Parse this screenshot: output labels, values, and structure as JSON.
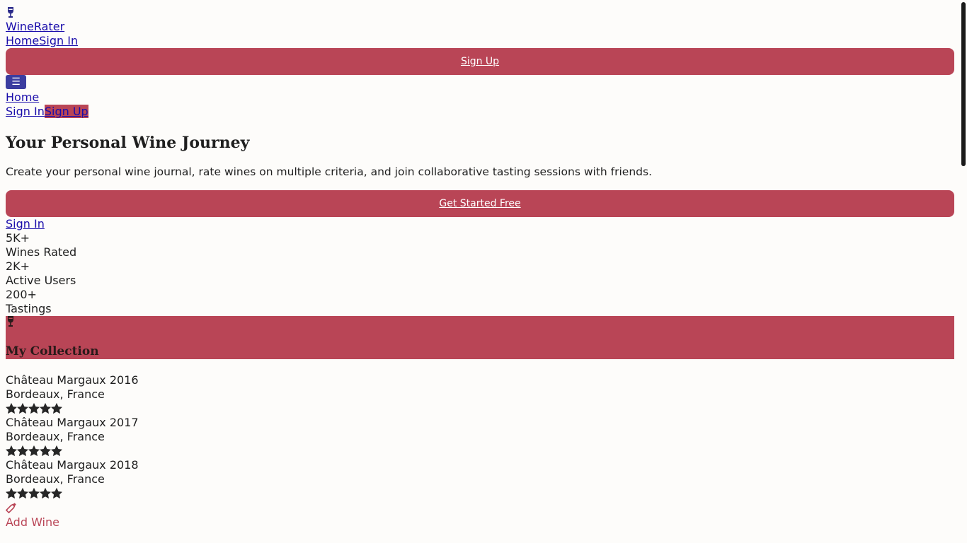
{
  "brand": {
    "name": "WineRater",
    "icon": "wine-glass-icon"
  },
  "nav": {
    "home": "Home",
    "sign_in": "Sign In",
    "sign_up": "Sign Up",
    "menu_icon": "hamburger-icon",
    "menu_glyph": "☰"
  },
  "mobile_nav": {
    "home": "Home",
    "sign_in": "Sign In",
    "sign_up": "Sign Up"
  },
  "hero": {
    "title": "Your Personal Wine Journey",
    "description": "Create your personal wine journal, rate wines on multiple criteria, and join collaborative tasting sessions with friends.",
    "cta": "Get Started Free",
    "sign_in": "Sign In"
  },
  "stats": [
    {
      "value": "5K+",
      "label": "Wines Rated"
    },
    {
      "value": "2K+",
      "label": "Active Users"
    },
    {
      "value": "200+",
      "label": "Tastings"
    }
  ],
  "collection": {
    "title": "My Collection",
    "icon": "wine-glass-icon",
    "wines": [
      {
        "name": "Château Margaux 2016",
        "region": "Bordeaux, France",
        "rating": 5
      },
      {
        "name": "Château Margaux 2017",
        "region": "Bordeaux, France",
        "rating": 5
      },
      {
        "name": "Château Margaux 2018",
        "region": "Bordeaux, France",
        "rating": 5
      }
    ],
    "add_label": "Add Wine",
    "add_icon": "wine-bottle-icon"
  },
  "colors": {
    "accent": "#b94556",
    "link": "#1a0dab",
    "menu_button": "#3b3da0",
    "background": "#fdfcfa"
  }
}
